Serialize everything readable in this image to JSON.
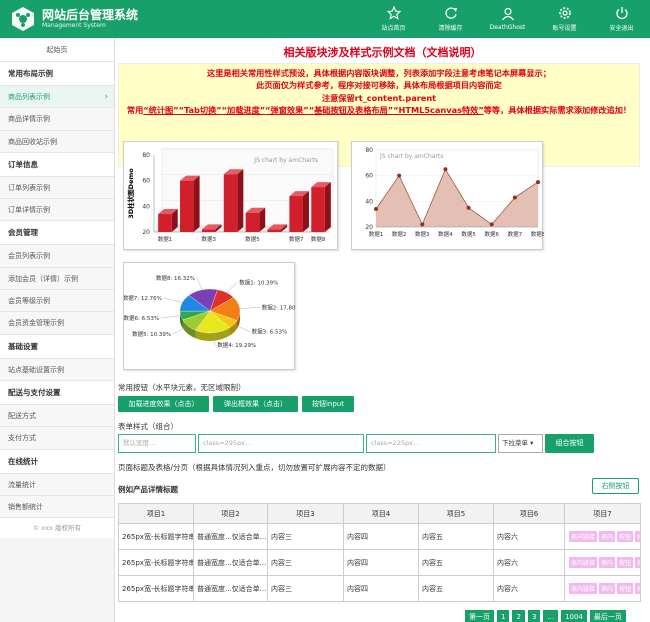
{
  "header": {
    "title": "网站后台管理系统",
    "subtitle": "Management System",
    "nav": [
      {
        "label": "站点首页",
        "icon": "star-icon"
      },
      {
        "label": "清除缓存",
        "icon": "refresh-icon"
      },
      {
        "label": "DeathGhost",
        "icon": "user-icon"
      },
      {
        "label": "账号设置",
        "icon": "gear-icon"
      },
      {
        "label": "安全退出",
        "icon": "power-icon"
      }
    ]
  },
  "sidebar": {
    "home": "起始页",
    "groups": [
      {
        "title": "常用布局示例",
        "items": [
          "商品列表示例",
          "商品详情示例",
          "商品回收站示例"
        ]
      },
      {
        "title": "订单信息",
        "items": [
          "订单列表示例",
          "订单详情示例"
        ]
      },
      {
        "title": "会员管理",
        "items": [
          "会员列表示例",
          "添加会员（详情）示例",
          "会员等级示例",
          "会员资金管理示例"
        ]
      },
      {
        "title": "基础设置",
        "items": [
          "站点基础设置示例"
        ]
      },
      {
        "title": "配送与支付设置",
        "items": [
          "配送方式",
          "支付方式"
        ]
      },
      {
        "title": "在线统计",
        "items": [
          "流量统计",
          "销售额统计"
        ]
      }
    ],
    "footer": "© xxx 版权所有"
  },
  "main": {
    "doc_title": "相关版块涉及样式示例文档（文档说明）",
    "notice": {
      "line1": "这里是相关常用性样式预设，具体根据内容版块调整，列表添加字段注意考虑笔记本屏幕显示；",
      "line2": "此页面仅为样式参考，程序对接可移除，具体布局根据项目内容而定",
      "line3": "注意保留rt_content.parent",
      "line4_prefix": "常用",
      "links": [
        "“统计图”",
        "“Tab切换”",
        "“加载进度”",
        "“弹窗效果”",
        "“基础按钮及表格布局”",
        "“HTML5canvas特效”"
      ],
      "line4_suffix": "等等，具体根据实际需求添加修改追加！"
    },
    "buttons_label": "常用按钮（水平块元素，无区域限制）",
    "buttons": [
      "加载进度效果（点击）",
      "弹出框效果（点击）",
      "按钮input"
    ],
    "forms_label": "表单样式（组合）",
    "inputs": [
      {
        "placeholder": "默认宽度..."
      },
      {
        "placeholder": "class=295px..."
      },
      {
        "placeholder": "class=225px..."
      }
    ],
    "select_value": "下拉菜单",
    "combo_button": "组合按钮",
    "table_note": "页面标题及表格/分页（根据具体情况列入重点，切勿放置可扩展内容不定的数据）",
    "table_title": "例如产品详情标题",
    "right_button": "右侧按钮",
    "table": {
      "headers": [
        "项目1",
        "项目2",
        "项目3",
        "项目4",
        "项目5",
        "项目6",
        "项目7"
      ],
      "rows": [
        [
          "265px宽-长标题字符串截断...",
          "普通宽度...仅适合单...",
          "内容三",
          "内容四",
          "内容五",
          "内容六"
        ],
        [
          "265px宽-长标题字符串截断...",
          "普通宽度...仅适合单...",
          "内容三",
          "内容四",
          "内容五",
          "内容六"
        ],
        [
          "265px宽-长标题字符串截断...",
          "普通宽度...仅适合单...",
          "内容三",
          "内容四",
          "内容五",
          "内容六"
        ]
      ],
      "tags": [
        "表内链接",
        "表内",
        "按钮",
        "按钮"
      ]
    },
    "pager": [
      "第一页",
      "1",
      "2",
      "3",
      "...",
      "1004",
      "最后一页"
    ]
  },
  "chart_data": [
    {
      "type": "bar",
      "watermark": "JS chart by amCharts",
      "ylabel": "3D柱状图Demo",
      "categories": [
        "数据1",
        "数据2",
        "数据3",
        "数据4",
        "数据5",
        "数据6",
        "数据7",
        "数据8"
      ],
      "values": [
        34,
        60,
        22,
        65,
        35,
        22,
        48,
        55
      ],
      "ylim": [
        20,
        80
      ],
      "yticks": [
        "80",
        "60",
        "40",
        "20"
      ],
      "color": "#d11f2b"
    },
    {
      "type": "area",
      "watermark": "JS chart by amCharts",
      "categories": [
        "数据1",
        "数据2",
        "数据3",
        "数据4",
        "数据5",
        "数据6",
        "数据7",
        "数据8"
      ],
      "values": [
        34,
        60,
        22,
        65,
        35,
        22,
        43,
        55
      ],
      "ylim": [
        20,
        80
      ],
      "yticks": [
        "80",
        "60",
        "40",
        "20"
      ],
      "color": "#c67a62"
    },
    {
      "type": "pie",
      "slices": [
        {
          "label": "数据1: 10.39%",
          "value": 10.39,
          "color": "#e0302a"
        },
        {
          "label": "数据2: 17.80%",
          "value": 17.8,
          "color": "#f57f17"
        },
        {
          "label": "数据3: 6.53%",
          "value": 6.53,
          "color": "#f6c70e"
        },
        {
          "label": "数据4: 19.29%",
          "value": 19.29,
          "color": "#e7e81f"
        },
        {
          "label": "数据5: 10.39%",
          "value": 10.39,
          "color": "#9ccc30"
        },
        {
          "label": "数据6: 6.53%",
          "value": 6.53,
          "color": "#2ea84a"
        },
        {
          "label": "数据7: 12.76%",
          "value": 12.76,
          "color": "#1e88e5"
        },
        {
          "label": "数据8: 16.32%",
          "value": 16.32,
          "color": "#7b3fb8"
        }
      ]
    }
  ]
}
